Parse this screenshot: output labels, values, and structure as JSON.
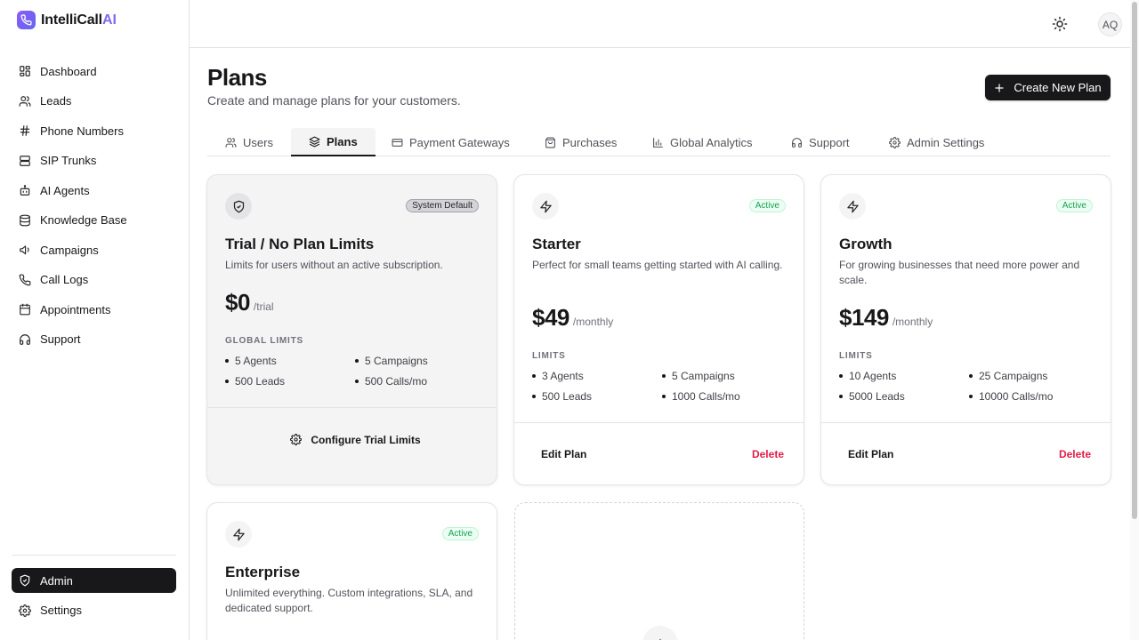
{
  "brand": {
    "name": "IntelliCall",
    "suffix": "AI"
  },
  "sidebar": {
    "items": [
      {
        "label": "Dashboard",
        "icon": "dashboard-icon"
      },
      {
        "label": "Leads",
        "icon": "users-icon"
      },
      {
        "label": "Phone Numbers",
        "icon": "hash-icon"
      },
      {
        "label": "SIP Trunks",
        "icon": "server-icon"
      },
      {
        "label": "AI Agents",
        "icon": "bot-icon"
      },
      {
        "label": "Knowledge Base",
        "icon": "database-icon"
      },
      {
        "label": "Campaigns",
        "icon": "megaphone-icon"
      },
      {
        "label": "Call Logs",
        "icon": "phone-icon"
      },
      {
        "label": "Appointments",
        "icon": "calendar-icon"
      },
      {
        "label": "Support",
        "icon": "headphones-icon"
      }
    ],
    "bottom": [
      {
        "label": "Admin",
        "icon": "shield-icon",
        "active": true
      },
      {
        "label": "Settings",
        "icon": "gear-icon"
      }
    ]
  },
  "topbar": {
    "avatar_initials": "AQ",
    "theme_icon": "sun-icon"
  },
  "header": {
    "title": "Plans",
    "subtitle": "Create and manage plans for your customers.",
    "create_button": "Create New Plan"
  },
  "tabs": [
    {
      "label": "Users",
      "icon": "users-icon"
    },
    {
      "label": "Plans",
      "icon": "layers-icon",
      "active": true
    },
    {
      "label": "Payment Gateways",
      "icon": "credit-card-icon"
    },
    {
      "label": "Purchases",
      "icon": "shopping-bag-icon"
    },
    {
      "label": "Global Analytics",
      "icon": "bar-chart-icon"
    },
    {
      "label": "Support",
      "icon": "headphones-icon"
    },
    {
      "label": "Admin Settings",
      "icon": "gear-icon"
    }
  ],
  "plans": [
    {
      "badge": "System Default",
      "title": "Trial / No Plan Limits",
      "description": "Limits for users without an active subscription.",
      "price": "$0",
      "period": "/trial",
      "limits_label": "GLOBAL LIMITS",
      "limits": [
        "5 Agents",
        "5 Campaigns",
        "500 Leads",
        "500 Calls/mo"
      ],
      "action": "Configure Trial Limits"
    },
    {
      "badge": "Active",
      "title": "Starter",
      "description": "Perfect for small teams getting started with AI calling.",
      "price": "$49",
      "period": "/monthly",
      "limits_label": "LIMITS",
      "limits": [
        "3 Agents",
        "5 Campaigns",
        "500 Leads",
        "1000 Calls/mo"
      ],
      "edit": "Edit Plan",
      "delete": "Delete"
    },
    {
      "badge": "Active",
      "title": "Growth",
      "description": "For growing businesses that need more power and scale.",
      "price": "$149",
      "period": "/monthly",
      "limits_label": "LIMITS",
      "limits": [
        "10 Agents",
        "25 Campaigns",
        "5000 Leads",
        "10000 Calls/mo"
      ],
      "edit": "Edit Plan",
      "delete": "Delete"
    },
    {
      "badge": "Active",
      "title": "Enterprise",
      "description": "Unlimited everything. Custom integrations, SLA, and dedicated support."
    }
  ],
  "colors": {
    "accent": "#18181b",
    "brand": "#7c6cf0",
    "active_badge": "#16a34a",
    "danger": "#e11d48"
  }
}
